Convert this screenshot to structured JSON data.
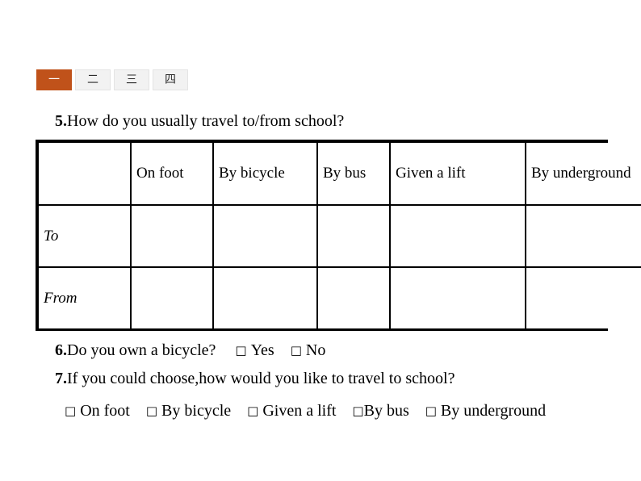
{
  "tabs": [
    {
      "label": "一",
      "active": true
    },
    {
      "label": "二",
      "active": false
    },
    {
      "label": "三",
      "active": false
    },
    {
      "label": "四",
      "active": false
    }
  ],
  "colors": {
    "active_tab_bg": "#c0521a",
    "active_tab_text": "#ffffff",
    "inactive_tab_bg": "#f2f2f2",
    "inactive_tab_border": "#e4e4e4",
    "table_border": "#000000",
    "page_bg": "#ffffff",
    "text": "#000000"
  },
  "question5": {
    "number": "5.",
    "text": "How do you usually travel to/from school?"
  },
  "table": {
    "headers": [
      "",
      "On foot",
      "By bicycle",
      "By bus",
      "Given a lift",
      "By underground"
    ],
    "rows": [
      {
        "label": "To",
        "cells": [
          "",
          "",
          "",
          "",
          ""
        ]
      },
      {
        "label": "From",
        "cells": [
          "",
          "",
          "",
          "",
          ""
        ]
      }
    ]
  },
  "question6": {
    "number": "6.",
    "text": "Do you own a bicycle?",
    "checkbox_glyph": "□",
    "options": [
      "Yes",
      "No"
    ]
  },
  "question7": {
    "number": "7.",
    "text": "If you could choose,how would you like to travel to school?",
    "checkbox_glyph": "□",
    "options": [
      "On foot",
      "By bicycle",
      "Given a lift",
      "By bus",
      "By underground"
    ]
  }
}
